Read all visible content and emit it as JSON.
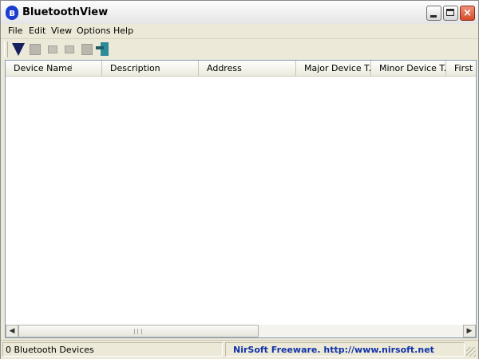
{
  "window": {
    "title": "BluetoothView",
    "icon": "bluetooth-icon",
    "controls": {
      "minimize": "minimize-icon",
      "maximize": "maximize-icon",
      "close": "×"
    }
  },
  "menu": [
    "File",
    "Edit",
    "View",
    "Options",
    "Help"
  ],
  "toolbar": {
    "buttons": [
      "start-stop-icon",
      "save-icon",
      "copy-icon",
      "properties-icon",
      "find-icon",
      "exit-icon"
    ]
  },
  "columns": [
    "Device Name",
    "Description",
    "Address",
    "Major Device T...",
    "Minor Device T...",
    "First D"
  ],
  "sort_indicator": "/",
  "rows": [],
  "scrollbar": {
    "left_arrow": "◀",
    "right_arrow": "▶"
  },
  "status": {
    "count_text": "0 Bluetooth Devices",
    "credit_text": "NirSoft Freeware.  http://www.nirsoft.net"
  },
  "colors": {
    "titlebar": "#f0f0f0",
    "link": "#1133a8",
    "face": "#ece9d8"
  }
}
